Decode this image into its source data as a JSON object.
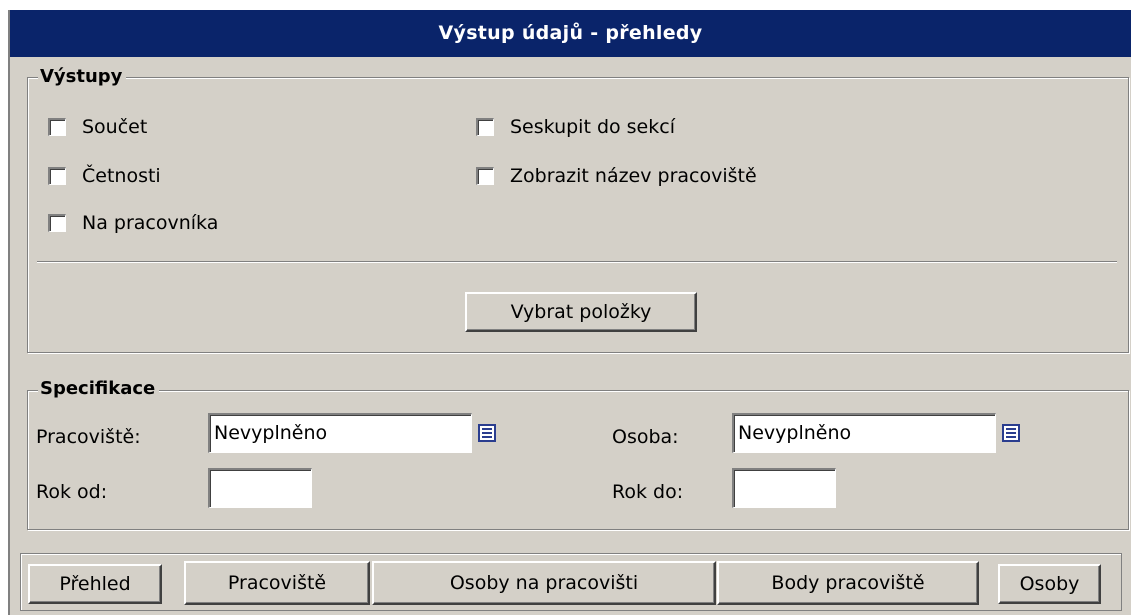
{
  "title": "Výstup údajů - přehledy",
  "outputs": {
    "legend": "Výstupy",
    "checkboxes": {
      "soucet": "Součet",
      "cetnosti": "Četnosti",
      "na_pracovnika": "Na pracovníka",
      "seskupit": "Seskupit do sekcí",
      "zobrazit": "Zobrazit název pracoviště"
    },
    "select_button": "Vybrat položky"
  },
  "spec": {
    "legend": "Specifikace",
    "pracoviste_label": "Pracoviště:",
    "pracoviste_value": "Nevyplněno",
    "osoba_label": "Osoba:",
    "osoba_value": "Nevyplněno",
    "rok_od_label": "Rok od:",
    "rok_od_value": "",
    "rok_do_label": "Rok do:",
    "rok_do_value": ""
  },
  "bottom": {
    "prehled": "Přehled",
    "pracoviste": "Pracoviště",
    "osoby_na_pracovisti": "Osoby na pracovišti",
    "body_pracoviste": "Body pracoviště",
    "osoby": "Osoby"
  },
  "colors": {
    "titlebar": "#0a246a",
    "panel": "#d4d0c8"
  },
  "icons": {
    "picker": "list-picker-icon"
  }
}
